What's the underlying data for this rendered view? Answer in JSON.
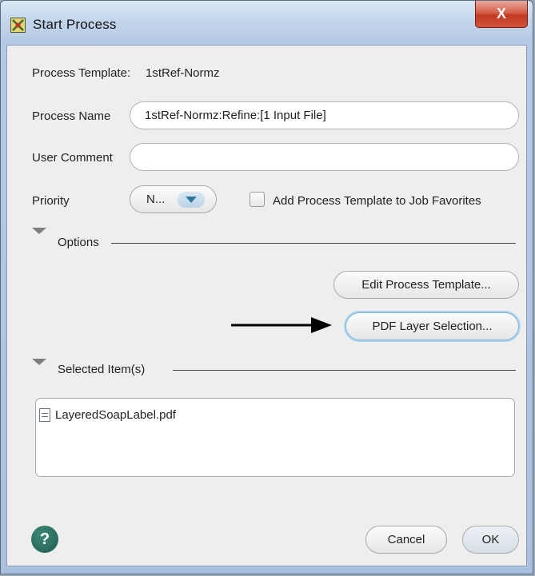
{
  "window": {
    "title": "Start  Process",
    "close_glyph": "X"
  },
  "form": {
    "template_label": "Process Template:",
    "template_value": "1stRef-Normz",
    "name_label": "Process Name",
    "name_value": "1stRef-Normz:Refine:[1 Input File]",
    "comment_label": "User Comment",
    "comment_value": "",
    "priority_label": "Priority",
    "priority_value": "N...",
    "favorites_label": "Add Process Template to Job Favorites",
    "favorites_checked": false
  },
  "options": {
    "section_label": "Options",
    "edit_template_label": "Edit Process Template...",
    "pdf_layer_label": "PDF Layer Selection..."
  },
  "selected": {
    "section_label": "Selected Item(s)",
    "items": [
      "LayeredSoapLabel.pdf"
    ]
  },
  "footer": {
    "help_glyph": "?",
    "cancel_label": "Cancel",
    "ok_label": "OK"
  },
  "colors": {
    "accent": "#2f7a9a",
    "help": "#1f5b4f",
    "close": "#c0391f"
  }
}
